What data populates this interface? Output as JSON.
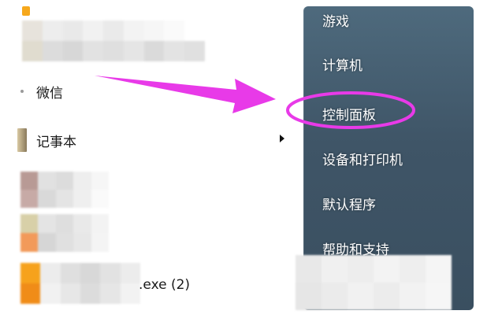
{
  "left_panel": {
    "items": [
      {
        "label": "微信",
        "icon": "wechat-icon"
      },
      {
        "label": "记事本",
        "icon": "notepad-icon"
      }
    ],
    "partial_item_label": ".exe (2)"
  },
  "right_panel": {
    "items": [
      {
        "label": "游戏"
      },
      {
        "label": "计算机"
      },
      {
        "label": "控制面板"
      },
      {
        "label": "设备和打印机"
      },
      {
        "label": "默认程序"
      },
      {
        "label": "帮助和支持"
      }
    ]
  },
  "annotation": {
    "color": "#e83ae8",
    "highlighted_item": "控制面板"
  }
}
